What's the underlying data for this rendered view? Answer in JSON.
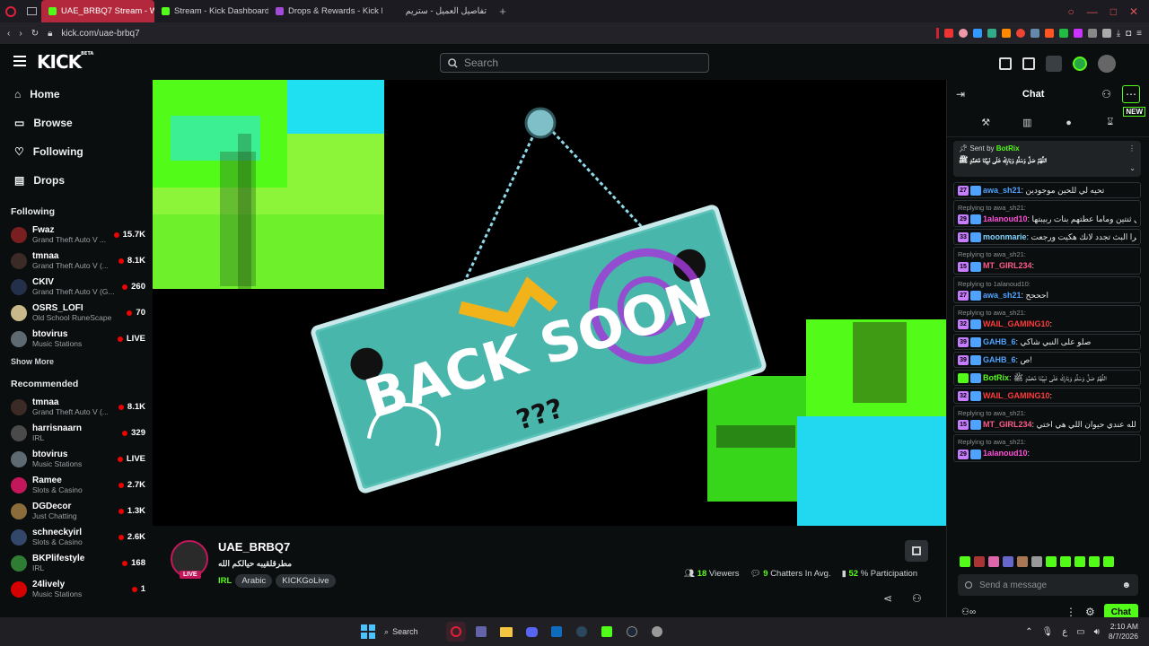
{
  "browser": {
    "tabs": [
      {
        "label": "UAE_BRBQ7 Stream - Watc",
        "active": true
      },
      {
        "label": "Stream - Kick Dashboard",
        "active": false
      },
      {
        "label": "Drops & Rewards - Kick Da",
        "active": false
      },
      {
        "label": "تفاصيل العميل - ستريم",
        "active": false
      }
    ],
    "url": "kick.com/uae-brbq7"
  },
  "header": {
    "logo": "KICK",
    "logo_badge": "BETA",
    "search_placeholder": "Search"
  },
  "sidebar": {
    "nav": [
      {
        "label": "Home",
        "icon": "home-icon"
      },
      {
        "label": "Browse",
        "icon": "browse-icon"
      },
      {
        "label": "Following",
        "icon": "heart-icon"
      },
      {
        "label": "Drops",
        "icon": "drops-icon"
      }
    ],
    "following_title": "Following",
    "following": [
      {
        "name": "Fwaz",
        "category": "Grand Theft Auto V ...",
        "viewers": "15.7K",
        "color": "#7a1f1f"
      },
      {
        "name": "tmnaa",
        "category": "Grand Theft Auto V (...",
        "viewers": "8.1K",
        "color": "#3b2a25"
      },
      {
        "name": "CKIV",
        "category": "Grand Theft Auto V (G...",
        "viewers": "260",
        "color": "#24304a"
      },
      {
        "name": "OSRS_LOFI",
        "category": "Old School RuneScape",
        "viewers": "70",
        "color": "#c9b98a"
      },
      {
        "name": "btovirus",
        "category": "Music Stations",
        "viewers": "LIVE",
        "color": "#5e6a72"
      }
    ],
    "show_more": "Show More",
    "recommended_title": "Recommended",
    "recommended": [
      {
        "name": "tmnaa",
        "category": "Grand Theft Auto V (...",
        "viewers": "8.1K",
        "color": "#3b2a25"
      },
      {
        "name": "harrisnaarn",
        "category": "IRL",
        "viewers": "329",
        "color": "#4a4a4a"
      },
      {
        "name": "btovirus",
        "category": "Music Stations",
        "viewers": "LIVE",
        "color": "#5e6a72"
      },
      {
        "name": "Ramee",
        "category": "Slots & Casino",
        "viewers": "2.7K",
        "color": "#c2185b"
      },
      {
        "name": "DGDecor",
        "category": "Just Chatting",
        "viewers": "1.3K",
        "color": "#8a6d3b"
      },
      {
        "name": "schneckyirl",
        "category": "Slots & Casino",
        "viewers": "2.6K",
        "color": "#33476b"
      },
      {
        "name": "BKPlifestyle",
        "category": "IRL",
        "viewers": "168",
        "color": "#2e7d32"
      },
      {
        "name": "24lively",
        "category": "Music Stations",
        "viewers": "1",
        "color": "#d50000"
      }
    ]
  },
  "video": {
    "sign_text": "BACK SOON",
    "sign_small": "???"
  },
  "stream": {
    "name": "UAE_BRBQ7",
    "title": "مطرقلقيبه حيالكم الله",
    "live_badge": "LIVE",
    "category": "IRL",
    "tags": [
      "Arabic",
      "KICKGoLive"
    ],
    "viewers": "18",
    "viewers_label": "Viewers",
    "chatters": "9",
    "chatters_label": "Chatters In Avg.",
    "participation": "52",
    "participation_label": "% Participation"
  },
  "chat": {
    "title": "Chat",
    "new_badge": "NEW",
    "pinned_by_label": "Sent by",
    "pinned_user": "BotRix",
    "pinned_text": "اللَّهُمَّ صَلِّ وَسَلِّمْ وَبَارِكْ عَلَى نَبِيِّنَا مُحَمَّدٍ ﷺ",
    "messages": [
      {
        "reply": "",
        "badge": "27",
        "user": "awa_sh21",
        "color": "#4fa3ff",
        "text": "تحيه لي للحين موجودين"
      },
      {
        "reply": "Replying to awa_sh21:",
        "badge": "29",
        "user": "1alanoud10",
        "color": "#ff4fd8",
        "text": "أنا كان عندي ثنتين وماما عطتهم بنات ربيبتها"
      },
      {
        "reply": "",
        "badge": "33",
        "user": "moonmarie",
        "color": "#7fd4ff",
        "text": "اووه ترا البث تجدد لانك هكيت ورجعت"
      },
      {
        "reply": "Replying to awa_sh21:",
        "badge": "15",
        "user": "MT_GIRL234",
        "color": "#ff5a8a",
        "text": ""
      },
      {
        "reply": "Replying to 1alanoud10:",
        "badge": "27",
        "user": "awa_sh21",
        "color": "#4fa3ff",
        "text": "احححح"
      },
      {
        "reply": "Replying to awa_sh21:",
        "badge": "32",
        "user": "WAIL_GAMING10",
        "color": "#ff3b3b",
        "text": ""
      },
      {
        "reply": "",
        "badge": "39",
        "user": "GAHB_6",
        "color": "#4fa3ff",
        "text": "صلو على النبي شاكي"
      },
      {
        "reply": "",
        "badge": "39",
        "user": "GAHB_6",
        "color": "#4fa3ff",
        "text": "ص!"
      },
      {
        "reply": "",
        "badge": "",
        "user": "BotRix",
        "color": "#53fc18",
        "text": "اللَّهُمَّ صَلِّ وَسَلِّمْ وَبَارِكْ عَلَى نَبِيِّنَا مُحَمَّدٍ ﷺ"
      },
      {
        "reply": "",
        "badge": "32",
        "user": "WAIL_GAMING10",
        "color": "#ff3b3b",
        "text": ""
      },
      {
        "reply": "Replying to awa_sh21:",
        "badge": "15",
        "user": "MT_GIRL234",
        "color": "#ff5a8a",
        "text": "انا الحمدلله عندي حيوان اللي هي اختي"
      },
      {
        "reply": "Replying to awa_sh21:",
        "badge": "29",
        "user": "1alanoud10",
        "color": "#ff4fd8",
        "text": ""
      }
    ],
    "input_placeholder": "Send a message",
    "chat_button": "Chat"
  },
  "taskbar": {
    "search_label": "Search",
    "time": "2:10 AM",
    "date": "8/7/2026",
    "lang": "ع"
  },
  "colors": {
    "accent": "#53fc18",
    "live": "#eb0400",
    "tab_active": "#b3283c"
  }
}
